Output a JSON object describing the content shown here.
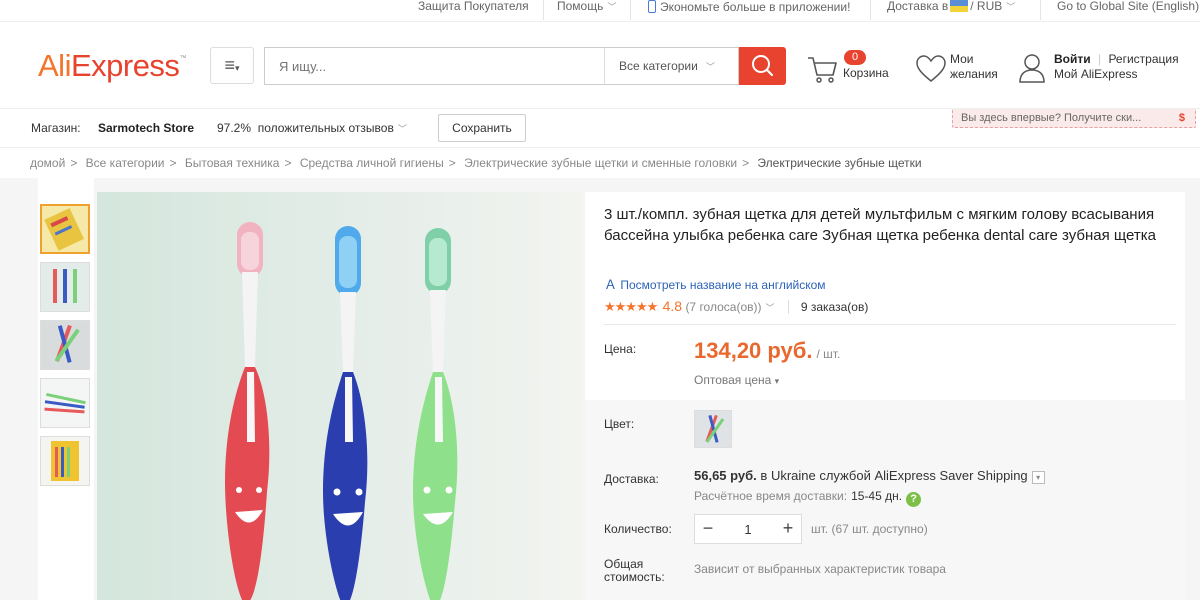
{
  "topbar": {
    "buyer_protection": "Защита Покупателя",
    "help": "Помощь",
    "app_promo": "Экономьте больше в приложении!",
    "delivery": "Доставка в",
    "currency": "RUB",
    "global_site": "Go to Global Site (English)"
  },
  "header": {
    "logo_ali": "Ali",
    "logo_express": "Express",
    "search_placeholder": "Я ищу...",
    "search_category": "Все категории",
    "cart_count": "0",
    "cart_label": "Корзина",
    "wishlist_line1": "Мои",
    "wishlist_line2": "желания",
    "login": "Войти",
    "register": "Регистрация",
    "my_account": "Мой AliExpress",
    "promo": "Вы здесь впервые? Получите ски...",
    "promo_icon": "$"
  },
  "store": {
    "label": "Магазин:",
    "name": "Sarmotech Store",
    "rating_pct": "97.2%",
    "rating_text": "положительных отзывов",
    "save_button": "Сохранить"
  },
  "breadcrumb": [
    "домой",
    "Все категории",
    "Бытовая техника",
    "Средства личной гигиены",
    "Электрические зубные щетки и сменные головки",
    "Электрические зубные щетки"
  ],
  "product": {
    "title": "3 шт./компл. зубная щетка для детей мультфильм с мягким голову всасывания бассейна улыбка ребенка care Зубная щетка ребенка dental care зубная щетка",
    "translate_link": "Посмотреть название на английском",
    "stars": "★★★★★",
    "rating": "4.8",
    "votes": "(7 голоса(ов))",
    "orders": "9 заказа(ов)",
    "price_label": "Цена:",
    "price": "134,20 руб.",
    "price_unit": "/ шт.",
    "wholesale": "Оптовая цена",
    "color_label": "Цвет:",
    "shipping_label": "Доставка:",
    "shipping_price": "56,65 руб.",
    "shipping_to": "в Ukraine службой AliExpress Saver Shipping",
    "eta_label": "Расчётное время доставки:",
    "eta_value": "15-45 дн.",
    "qty_label": "Количество:",
    "qty_value": "1",
    "qty_available": "шт. (67 шт. доступно)",
    "total_label_1": "Общая",
    "total_label_2": "стоимость:",
    "total_value": "Зависит от выбранных характеристик товара"
  },
  "colors": {
    "accent": "#e8432e",
    "logo_orange": "#f5742a",
    "price": "#e8682e",
    "link": "#2c63b8"
  }
}
